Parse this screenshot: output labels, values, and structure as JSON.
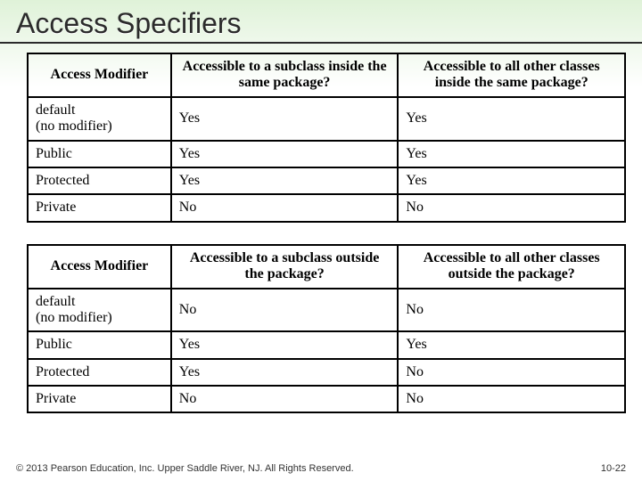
{
  "title": "Access Specifiers",
  "table1": {
    "headers": [
      "Access Modifier",
      "Accessible to a subclass inside the same package?",
      "Accessible to all other classes inside the same package?"
    ],
    "rows": [
      [
        "default\n(no modifier)",
        "Yes",
        "Yes"
      ],
      [
        "Public",
        "Yes",
        "Yes"
      ],
      [
        "Protected",
        "Yes",
        "Yes"
      ],
      [
        "Private",
        "No",
        "No"
      ]
    ]
  },
  "table2": {
    "headers": [
      "Access Modifier",
      "Accessible to a subclass outside the package?",
      "Accessible to all other classes outside the package?"
    ],
    "rows": [
      [
        "default\n(no modifier)",
        "No",
        "No"
      ],
      [
        "Public",
        "Yes",
        "Yes"
      ],
      [
        "Protected",
        "Yes",
        "No"
      ],
      [
        "Private",
        "No",
        "No"
      ]
    ]
  },
  "footer": {
    "copyright": "© 2013 Pearson Education, Inc. Upper Saddle River, NJ. All Rights Reserved.",
    "page": "10-22"
  }
}
